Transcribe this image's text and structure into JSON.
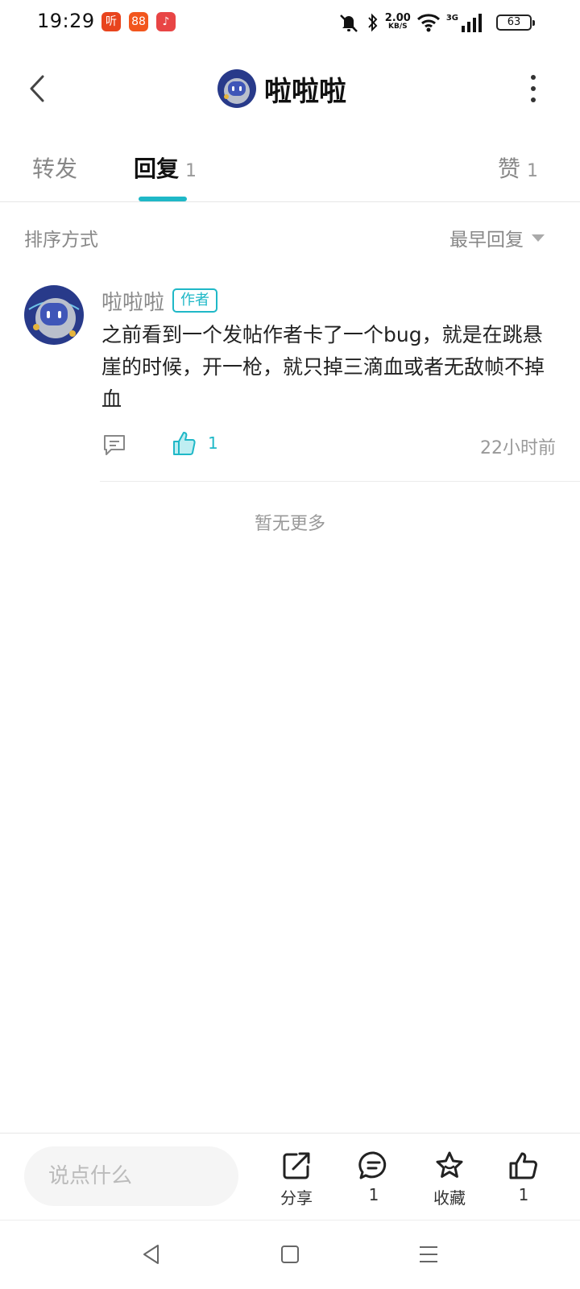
{
  "status_bar": {
    "time": "19:29",
    "app_badges": [
      "听",
      "88",
      "♪"
    ],
    "net_speed_value": "2.00",
    "net_speed_unit": "KB/S",
    "network_type": "3G",
    "battery_level": "63",
    "icons": [
      "mute-bell-icon",
      "bluetooth-icon",
      "wifi-icon",
      "signal-icon",
      "battery-icon"
    ]
  },
  "header": {
    "title": "啦啦啦",
    "back_icon": "chevron-left-icon",
    "more_icon": "more-vertical-icon"
  },
  "tabs": [
    {
      "label": "转发",
      "count": ""
    },
    {
      "label": "回复",
      "count": "1",
      "active": true
    },
    {
      "label": "赞",
      "count": "1"
    }
  ],
  "accent_color": "#1fb8c7",
  "sort": {
    "label": "排序方式",
    "selected": "最早回复"
  },
  "replies": [
    {
      "author": "啦啦啦",
      "badge": "作者",
      "text": "之前看到一个发帖作者卡了一个bug，就是在跳悬崖的时候，开一枪，就只掉三滴血或者无敌帧不掉血",
      "like_count": "1",
      "time": "22小时前"
    }
  ],
  "no_more": "暂无更多",
  "bottom_bar": {
    "input_placeholder": "说点什么",
    "share_label": "分享",
    "comment_count": "1",
    "favorite_label": "收藏",
    "like_count": "1"
  }
}
